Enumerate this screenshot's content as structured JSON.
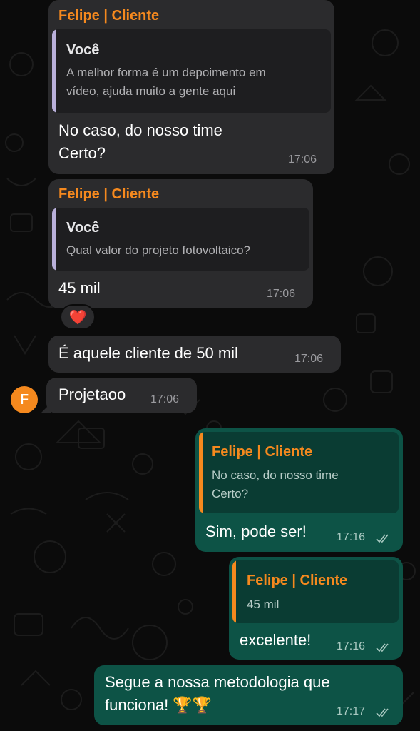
{
  "colors": {
    "background": "#0b0b0b",
    "incoming_bubble": "#2b2b2d",
    "outgoing_bubble": "#0d5346",
    "sender_name": "#f5891e",
    "timestamp": "#9a9a9e"
  },
  "messages": [
    {
      "direction": "incoming",
      "sender": "Felipe | Cliente",
      "quote_author": "Você",
      "quote_lines": [
        "A melhor forma é um depoimento em",
        "vídeo, ajuda muito a gente aqui"
      ],
      "text_lines": [
        "No caso, do nosso time",
        "Certo?"
      ],
      "time": "17:06"
    },
    {
      "direction": "incoming",
      "sender": "Felipe | Cliente",
      "quote_author": "Você",
      "quote_lines": [
        "Qual valor do projeto fotovoltaico?"
      ],
      "text_lines": [
        "45 mil"
      ],
      "time": "17:06",
      "reaction": "❤️"
    },
    {
      "direction": "incoming",
      "text_lines": [
        "É aquele cliente de 50 mil"
      ],
      "time": "17:06"
    },
    {
      "direction": "incoming",
      "avatar_letter": "F",
      "text_lines": [
        "Projetaoo"
      ],
      "time": "17:06"
    },
    {
      "direction": "outgoing",
      "quote_author": "Felipe | Cliente",
      "quote_lines": [
        "No caso, do nosso time",
        "Certo?"
      ],
      "text_lines": [
        "Sim, pode ser!"
      ],
      "time": "17:16",
      "status_icon": "double-check-icon"
    },
    {
      "direction": "outgoing",
      "quote_author": "Felipe | Cliente",
      "quote_lines": [
        "45 mil"
      ],
      "text_lines": [
        "excelente!"
      ],
      "time": "17:16",
      "status_icon": "double-check-icon"
    },
    {
      "direction": "outgoing",
      "text_lines": [
        "Segue a nossa metodologia que",
        "funciona! 🏆🏆"
      ],
      "time": "17:17",
      "status_icon": "double-check-icon"
    }
  ]
}
